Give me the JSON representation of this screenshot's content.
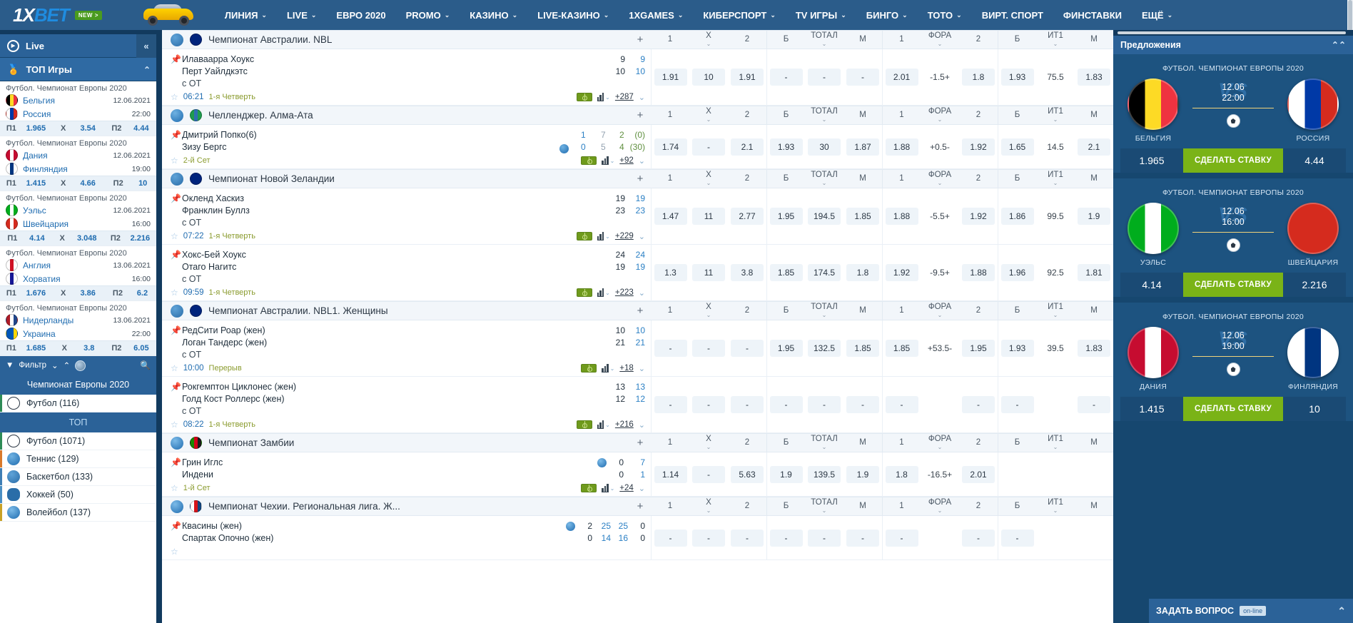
{
  "brand": {
    "logo_1": "1",
    "logo_x": "X",
    "logo_bet": "BET",
    "badge": "NEW >"
  },
  "topnav": {
    "items": [
      {
        "label": "ЛИНИЯ",
        "caret": true
      },
      {
        "label": "LIVE",
        "caret": true
      },
      {
        "label": "ЕВРО 2020",
        "caret": false
      },
      {
        "label": "PROMO",
        "caret": true
      },
      {
        "label": "КАЗИНО",
        "caret": true
      },
      {
        "label": "LIVE-КАЗИНО",
        "caret": true
      },
      {
        "label": "1XGAMES",
        "caret": true
      },
      {
        "label": "КИБЕРСПОРТ",
        "caret": true
      },
      {
        "label": "TV ИГРЫ",
        "caret": true
      },
      {
        "label": "БИНГО",
        "caret": true
      },
      {
        "label": "ТОТО",
        "caret": true
      },
      {
        "label": "ВИРТ. СПОРТ",
        "caret": false
      },
      {
        "label": "ФИНСТАВКИ",
        "caret": false
      },
      {
        "label": "ЕЩЁ",
        "caret": true
      }
    ]
  },
  "sidebar": {
    "live_label": "Live",
    "top_games_label": "ТОП Игры",
    "top_games": [
      {
        "league": "Футбол. Чемпионат Европы 2020",
        "home": "Бельгия",
        "away": "Россия",
        "date": "12.06.2021",
        "time": "22:00",
        "home_flag": [
          "#000000",
          "#fdda25",
          "#ef3340"
        ],
        "away_flag": [
          "#ffffff",
          "#0039a6",
          "#d52b1e"
        ],
        "odds": [
          [
            "П1",
            "1.965"
          ],
          [
            "Х",
            "3.54"
          ],
          [
            "П2",
            "4.44"
          ]
        ]
      },
      {
        "league": "Футбол. Чемпионат Европы 2020",
        "home": "Дания",
        "away": "Финляндия",
        "date": "12.06.2021",
        "time": "19:00",
        "home_flag": [
          "#c60c30",
          "#ffffff",
          "#c60c30"
        ],
        "away_flag": [
          "#ffffff",
          "#003580",
          "#ffffff"
        ],
        "odds": [
          [
            "П1",
            "1.415"
          ],
          [
            "Х",
            "4.66"
          ],
          [
            "П2",
            "10"
          ]
        ]
      },
      {
        "league": "Футбол. Чемпионат Европы 2020",
        "home": "Уэльс",
        "away": "Швейцария",
        "date": "12.06.2021",
        "time": "16:00",
        "home_flag": [
          "#00ad1d",
          "#ffffff",
          "#00ad1d"
        ],
        "away_flag": [
          "#d52b1e",
          "#ffffff",
          "#d52b1e"
        ],
        "odds": [
          [
            "П1",
            "4.14"
          ],
          [
            "Х",
            "3.048"
          ],
          [
            "П2",
            "2.216"
          ]
        ]
      },
      {
        "league": "Футбол. Чемпионат Европы 2020",
        "home": "Англия",
        "away": "Хорватия",
        "date": "13.06.2021",
        "time": "16:00",
        "home_flag": [
          "#ffffff",
          "#ce1124",
          "#ffffff"
        ],
        "away_flag": [
          "#ffffff",
          "#171796",
          "#ffffff"
        ],
        "odds": [
          [
            "П1",
            "1.676"
          ],
          [
            "Х",
            "3.86"
          ],
          [
            "П2",
            "6.2"
          ]
        ]
      },
      {
        "league": "Футбол. Чемпионат Европы 2020",
        "home": "Нидерланды",
        "away": "Украина",
        "date": "13.06.2021",
        "time": "22:00",
        "home_flag": [
          "#ae1c28",
          "#ffffff",
          "#21468b"
        ],
        "away_flag": [
          "#0057b7",
          "#0057b7",
          "#ffd700"
        ],
        "odds": [
          [
            "П1",
            "1.685"
          ],
          [
            "Х",
            "3.8"
          ],
          [
            "П2",
            "6.05"
          ]
        ]
      }
    ],
    "filter_label": "Фильтр",
    "euro_section_title": "Чемпионат Европы 2020",
    "euro_sports": [
      {
        "label": "Футбол (116)",
        "icon": "football-icon"
      }
    ],
    "top_section_title": "ТОП",
    "top_sports": [
      {
        "label": "Футбол (1071)",
        "icon": "football-icon"
      },
      {
        "label": "Теннис (129)",
        "icon": "tennis-icon"
      },
      {
        "label": "Баскетбол (133)",
        "icon": "basketball-icon"
      },
      {
        "label": "Хоккей (50)",
        "icon": "hockey-icon"
      },
      {
        "label": "Волейбол (137)",
        "icon": "volleyball-icon"
      }
    ]
  },
  "markets": {
    "headers": [
      {
        "label": "1",
        "dd": false
      },
      {
        "label": "Х",
        "dd": true
      },
      {
        "label": "2",
        "dd": false
      },
      {
        "label": "Б",
        "dd": false
      },
      {
        "label": "ТОТАЛ",
        "dd": true
      },
      {
        "label": "М",
        "dd": false
      },
      {
        "label": "1",
        "dd": false
      },
      {
        "label": "ФОРА",
        "dd": true
      },
      {
        "label": "2",
        "dd": false
      },
      {
        "label": "Б",
        "dd": false
      },
      {
        "label": "ИТ1",
        "dd": true
      },
      {
        "label": "М",
        "dd": false
      }
    ],
    "plus": "+"
  },
  "leagues": [
    {
      "name": "Чемпионат Австралии. NBL",
      "sport": "basketball-icon",
      "flag": [
        "#00247d",
        "#00247d",
        "#00247d"
      ],
      "events": [
        {
          "home": "Илаваарра Хоукс",
          "away": "Перт Уайлдкэтс",
          "sub": "с ОТ",
          "score_dark": [
            "9",
            "10"
          ],
          "score_blue": [
            "9",
            "10"
          ],
          "time": "06:21",
          "period": "1-я Четверть",
          "more": "+287",
          "odds": [
            "1.91",
            "10",
            "1.91",
            "-",
            "-",
            "-",
            "2.01",
            "-1.5+",
            "1.8",
            "1.93",
            "75.5",
            "1.83"
          ],
          "plain_idx": [
            7,
            10
          ]
        }
      ]
    },
    {
      "name": "Челленджер. Алма-Ата",
      "sport": "tennis-icon",
      "flag": [
        "#1e9c4e",
        "#2e6fb0",
        "#1e9c4e"
      ],
      "events": [
        {
          "home": "Дмитрий Попко(6)",
          "away": "Зизу Бергс",
          "sub": "",
          "tennis": true,
          "t_main": [
            "1",
            "0"
          ],
          "t_dim": [
            "7",
            "5"
          ],
          "t_green": [
            "2",
            "4"
          ],
          "t_games": [
            "(0)",
            "(30)"
          ],
          "serve_away": true,
          "time": "",
          "period": "2-й Сет",
          "more": "+92",
          "odds": [
            "1.74",
            "-",
            "2.1",
            "1.93",
            "30",
            "1.87",
            "1.88",
            "+0.5-",
            "1.92",
            "1.65",
            "14.5",
            "2.1"
          ],
          "plain_idx": [
            7,
            10
          ]
        }
      ]
    },
    {
      "name": "Чемпионат Новой Зеландии",
      "sport": "basketball-icon",
      "flag": [
        "#00247d",
        "#00247d",
        "#00247d"
      ],
      "events": [
        {
          "home": "Окленд Хаскиз",
          "away": "Франклин Буллз",
          "sub": "с ОТ",
          "score_dark": [
            "19",
            "23"
          ],
          "score_blue": [
            "19",
            "23"
          ],
          "time": "07:22",
          "period": "1-я Четверть",
          "more": "+229",
          "odds": [
            "1.47",
            "11",
            "2.77",
            "1.95",
            "194.5",
            "1.85",
            "1.88",
            "-5.5+",
            "1.92",
            "1.86",
            "99.5",
            "1.9"
          ],
          "plain_idx": [
            7,
            10
          ]
        },
        {
          "home": "Хокс-Бей Хоукс",
          "away": "Отаго Нагитс",
          "sub": "с ОТ",
          "score_dark": [
            "24",
            "19"
          ],
          "score_blue": [
            "24",
            "19"
          ],
          "time": "09:59",
          "period": "1-я Четверть",
          "more": "+223",
          "odds": [
            "1.3",
            "11",
            "3.8",
            "1.85",
            "174.5",
            "1.8",
            "1.92",
            "-9.5+",
            "1.88",
            "1.96",
            "92.5",
            "1.81"
          ],
          "plain_idx": [
            7,
            10
          ]
        }
      ]
    },
    {
      "name": "Чемпионат Австралии. NBL1. Женщины",
      "sport": "basketball-icon",
      "flag": [
        "#00247d",
        "#00247d",
        "#00247d"
      ],
      "events": [
        {
          "home": "РедСити Роар (жен)",
          "away": "Логан Тандерс (жен)",
          "sub": "с ОТ",
          "score_dark": [
            "10",
            "21"
          ],
          "score_blue": [
            "10",
            "21"
          ],
          "time": "10:00",
          "period": "Перерыв",
          "more": "+18",
          "odds": [
            "-",
            "-",
            "-",
            "1.95",
            "132.5",
            "1.85",
            "1.85",
            "+53.5-",
            "1.95",
            "1.93",
            "39.5",
            "1.83"
          ],
          "plain_idx": [
            7,
            10
          ]
        },
        {
          "home": "Рокгемптон Циклонес (жен)",
          "away": "Голд Кост Роллерс (жен)",
          "sub": "с ОТ",
          "score_dark": [
            "13",
            "12"
          ],
          "score_blue": [
            "13",
            "12"
          ],
          "time": "08:22",
          "period": "1-я Четверть",
          "more": "+216",
          "odds": [
            "-",
            "-",
            "-",
            "-",
            "-",
            "-",
            "-",
            "",
            "-",
            "-",
            "",
            "-"
          ],
          "plain_idx": [
            7,
            10
          ]
        }
      ]
    },
    {
      "name": "Чемпионат Замбии",
      "sport": "volleyball-icon",
      "flag": [
        "#198a00",
        "#d4001a",
        "#1b1b1b"
      ],
      "events": [
        {
          "home": "Грин Иглс",
          "away": "Индени",
          "sub": "",
          "volley": true,
          "v_dark": [
            "0",
            "0"
          ],
          "v_blue": [
            "7",
            "1"
          ],
          "serve_home": true,
          "time": "",
          "period": "1-й Сет",
          "more": "+24",
          "odds": [
            "1.14",
            "-",
            "5.63",
            "1.9",
            "139.5",
            "1.9",
            "1.8",
            "-16.5+",
            "2.01",
            "",
            "",
            ""
          ],
          "plain_idx": [
            7,
            10
          ]
        }
      ]
    },
    {
      "name": "Чемпионат Чехии. Региональная лига. Ж...",
      "sport": "volleyball-icon",
      "flag": [
        "#ffffff",
        "#d7141a",
        "#11457e"
      ],
      "events": [
        {
          "home": "Квасины (жен)",
          "away": "Спартак Опочно (жен)",
          "sub": "",
          "czech": true,
          "c_sets": [
            "2",
            "0"
          ],
          "c_p1": [
            "25",
            "14"
          ],
          "c_p2": [
            "25",
            "16"
          ],
          "c_p3": [
            "0",
            "0"
          ],
          "serve_home": true,
          "time": "",
          "period": "",
          "more": "",
          "odds": [
            "-",
            "-",
            "-",
            "-",
            "-",
            "-",
            "-",
            "",
            "-",
            "-",
            "",
            ""
          ],
          "plain_idx": [
            7,
            10
          ]
        }
      ]
    }
  ],
  "right_panel": {
    "offers_title": "Предложения",
    "offers": [
      {
        "title": "ФУТБОЛ. ЧЕМПИОНАТ ЕВРОПЫ 2020",
        "home": "БЕЛЬГИЯ",
        "away": "РОССИЯ",
        "date": "12.06",
        "time": "22:00",
        "odd_home": "1.965",
        "odd_away": "4.44",
        "bet_label": "СДЕЛАТЬ СТАВКУ",
        "home_flag": [
          "#000000",
          "#fdda25",
          "#ef3340"
        ],
        "away_flag": [
          "#ffffff",
          "#0039a6",
          "#d52b1e"
        ]
      },
      {
        "title": "ФУТБОЛ. ЧЕМПИОНАТ ЕВРОПЫ 2020",
        "home": "УЭЛЬС",
        "away": "ШВЕЙЦАРИЯ",
        "date": "12.06",
        "time": "16:00",
        "odd_home": "4.14",
        "odd_away": "2.216",
        "bet_label": "СДЕЛАТЬ СТАВКУ",
        "home_flag": [
          "#00ad1d",
          "#ffffff",
          "#00ad1d"
        ],
        "away_flag": [
          "#d52b1e",
          "#d52b1e",
          "#d52b1e"
        ]
      },
      {
        "title": "ФУТБОЛ. ЧЕМПИОНАТ ЕВРОПЫ 2020",
        "home": "ДАНИЯ",
        "away": "ФИНЛЯНДИЯ",
        "date": "12.06",
        "time": "19:00",
        "odd_home": "1.415",
        "odd_away": "10",
        "bet_label": "СДЕЛАТЬ СТАВКУ",
        "home_flag": [
          "#c60c30",
          "#ffffff",
          "#c60c30"
        ],
        "away_flag": [
          "#ffffff",
          "#003580",
          "#ffffff"
        ]
      }
    ],
    "chat_label": "ЗАДАТЬ ВОПРОС",
    "chat_status": "on-line"
  }
}
